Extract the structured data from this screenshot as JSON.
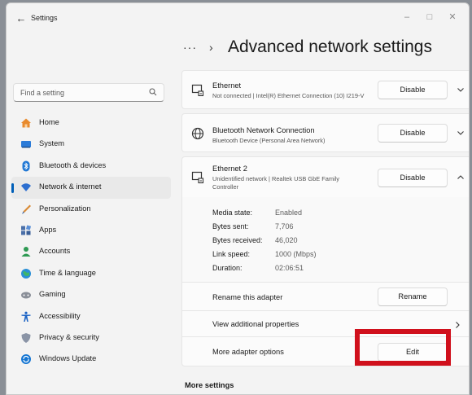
{
  "window": {
    "title": "Settings"
  },
  "search": {
    "placeholder": "Find a setting"
  },
  "sidebar": {
    "items": [
      {
        "label": "Home",
        "icon": "home-icon",
        "color": "#e88a2d"
      },
      {
        "label": "System",
        "icon": "system-icon",
        "color": "#2b7bd8"
      },
      {
        "label": "Bluetooth & devices",
        "icon": "bluetooth-icon",
        "color": "#1f77d4"
      },
      {
        "label": "Network & internet",
        "icon": "network-icon",
        "color": "#2d6fd0",
        "active": true
      },
      {
        "label": "Personalization",
        "icon": "personalization-icon",
        "color": "#d98a34"
      },
      {
        "label": "Apps",
        "icon": "apps-icon",
        "color": "#4a6fa8"
      },
      {
        "label": "Accounts",
        "icon": "accounts-icon",
        "color": "#2e9a53"
      },
      {
        "label": "Time & language",
        "icon": "time-language-icon",
        "color": "#2a8fd6"
      },
      {
        "label": "Gaming",
        "icon": "gaming-icon",
        "color": "#8a8f98"
      },
      {
        "label": "Accessibility",
        "icon": "accessibility-icon",
        "color": "#1a62c4"
      },
      {
        "label": "Privacy & security",
        "icon": "privacy-icon",
        "color": "#8a94a6"
      },
      {
        "label": "Windows Update",
        "icon": "windows-update-icon",
        "color": "#1676d2"
      }
    ]
  },
  "breadcrumb": {
    "more": "···",
    "separator": "›",
    "title": "Advanced network settings"
  },
  "adapters": [
    {
      "name": "Ethernet",
      "description": "Not connected | Intel(R) Ethernet Connection (10) I219-V",
      "button": "Disable",
      "expanded": false,
      "icon": "ethernet-icon"
    },
    {
      "name": "Bluetooth Network Connection",
      "description": "Bluetooth Device (Personal Area Network)",
      "button": "Disable",
      "expanded": false,
      "icon": "bluetooth-network-icon"
    },
    {
      "name": "Ethernet 2",
      "description": "Unidentified network | Realtek USB GbE Family Controller",
      "button": "Disable",
      "expanded": true,
      "icon": "ethernet-icon"
    }
  ],
  "details": [
    {
      "label": "Media state:",
      "value": "Enabled"
    },
    {
      "label": "Bytes sent:",
      "value": "7,706"
    },
    {
      "label": "Bytes received:",
      "value": "46,020"
    },
    {
      "label": "Link speed:",
      "value": "1000 (Mbps)"
    },
    {
      "label": "Duration:",
      "value": "02:06:51"
    }
  ],
  "actions": {
    "rename_label": "Rename this adapter",
    "rename_button": "Rename",
    "view_props_label": "View additional properties",
    "more_options_label": "More adapter options",
    "edit_button": "Edit"
  },
  "footer": {
    "more_settings": "More settings"
  },
  "colors": {
    "accent": "#005fb8",
    "highlight": "#d0101c"
  }
}
